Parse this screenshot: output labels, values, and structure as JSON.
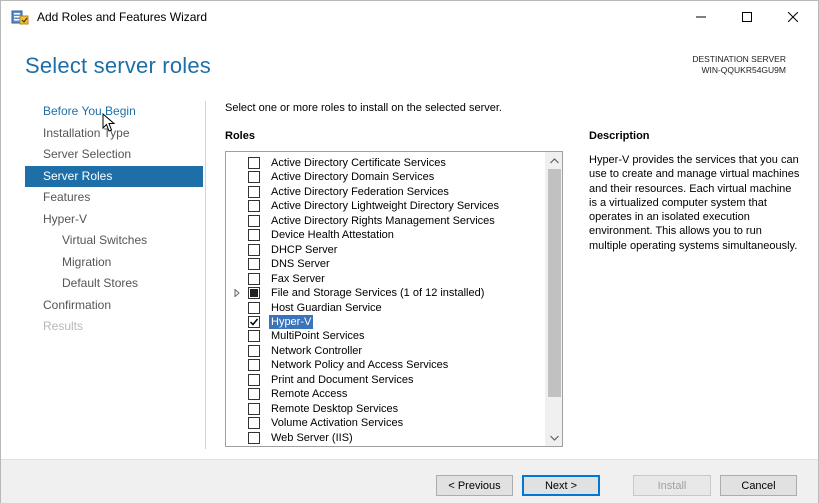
{
  "window": {
    "title": "Add Roles and Features Wizard",
    "icon": "server-manager-icon"
  },
  "header": {
    "page_title": "Select server roles",
    "destination_label": "DESTINATION SERVER",
    "destination_name": "WIN-QQUKR54GU9M"
  },
  "nav": {
    "items": [
      {
        "label": "Before You Begin",
        "state": "link"
      },
      {
        "label": "Installation Type",
        "state": "normal"
      },
      {
        "label": "Server Selection",
        "state": "normal"
      },
      {
        "label": "Server Roles",
        "state": "active"
      },
      {
        "label": "Features",
        "state": "normal"
      },
      {
        "label": "Hyper-V",
        "state": "normal"
      },
      {
        "label": "Virtual Switches",
        "state": "sub"
      },
      {
        "label": "Migration",
        "state": "sub"
      },
      {
        "label": "Default Stores",
        "state": "sub"
      },
      {
        "label": "Confirmation",
        "state": "normal"
      },
      {
        "label": "Results",
        "state": "disabled"
      }
    ]
  },
  "main": {
    "instruction": "Select one or more roles to install on the selected server.",
    "roles_heading": "Roles",
    "roles": [
      {
        "label": "Active Directory Certificate Services",
        "state": "unchecked"
      },
      {
        "label": "Active Directory Domain Services",
        "state": "unchecked"
      },
      {
        "label": "Active Directory Federation Services",
        "state": "unchecked"
      },
      {
        "label": "Active Directory Lightweight Directory Services",
        "state": "unchecked"
      },
      {
        "label": "Active Directory Rights Management Services",
        "state": "unchecked"
      },
      {
        "label": "Device Health Attestation",
        "state": "unchecked"
      },
      {
        "label": "DHCP Server",
        "state": "unchecked"
      },
      {
        "label": "DNS Server",
        "state": "unchecked"
      },
      {
        "label": "Fax Server",
        "state": "unchecked"
      },
      {
        "label": "File and Storage Services (1 of 12 installed)",
        "state": "partial",
        "expandable": true
      },
      {
        "label": "Host Guardian Service",
        "state": "unchecked"
      },
      {
        "label": "Hyper-V",
        "state": "checked",
        "selected": true
      },
      {
        "label": "MultiPoint Services",
        "state": "unchecked"
      },
      {
        "label": "Network Controller",
        "state": "unchecked"
      },
      {
        "label": "Network Policy and Access Services",
        "state": "unchecked"
      },
      {
        "label": "Print and Document Services",
        "state": "unchecked"
      },
      {
        "label": "Remote Access",
        "state": "unchecked"
      },
      {
        "label": "Remote Desktop Services",
        "state": "unchecked"
      },
      {
        "label": "Volume Activation Services",
        "state": "unchecked"
      },
      {
        "label": "Web Server (IIS)",
        "state": "unchecked"
      }
    ]
  },
  "description": {
    "heading": "Description",
    "text": "Hyper-V provides the services that you can use to create and manage virtual machines and their resources. Each virtual machine is a virtualized computer system that operates in an isolated execution environment. This allows you to run multiple operating systems simultaneously."
  },
  "footer": {
    "previous_label": "< Previous",
    "next_label": "Next >",
    "install_label": "Install",
    "cancel_label": "Cancel"
  },
  "colors": {
    "accent": "#1e6fa8",
    "selection": "#3b74b8"
  }
}
